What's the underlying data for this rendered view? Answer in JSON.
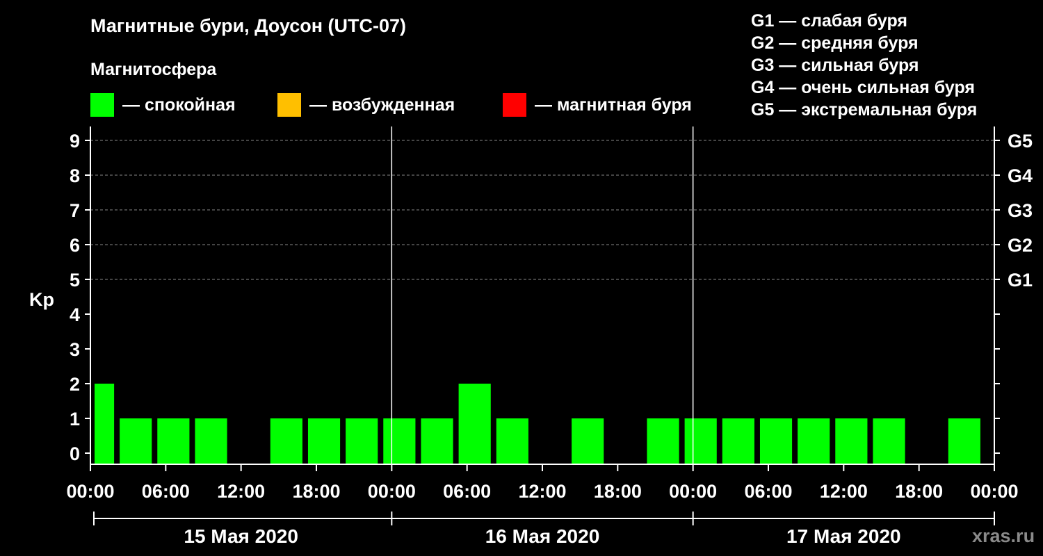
{
  "title": "Магнитные бури, Доусон (UTC-07)",
  "legend": {
    "header": "Магнитосфера",
    "items": [
      {
        "label": "— спокойная",
        "color": "#00ff00"
      },
      {
        "label": "— возбужденная",
        "color": "#ffbf00"
      },
      {
        "label": "— магнитная буря",
        "color": "#ff0000"
      }
    ]
  },
  "g_scale": [
    "G1 — слабая буря",
    "G2 — средняя буря",
    "G3 — сильная буря",
    "G4 — очень сильная буря",
    "G5 — экстремальная буря"
  ],
  "watermark": "xras.ru",
  "chart_data": {
    "type": "bar",
    "ylabel": "Kp",
    "ylim": [
      0,
      9
    ],
    "yticks": [
      "0",
      "1",
      "2",
      "3",
      "4",
      "5",
      "6",
      "7",
      "8",
      "9"
    ],
    "right_ticks": [
      {
        "kp": 5,
        "label": "G1"
      },
      {
        "kp": 6,
        "label": "G2"
      },
      {
        "kp": 7,
        "label": "G3"
      },
      {
        "kp": 8,
        "label": "G4"
      },
      {
        "kp": 9,
        "label": "G5"
      }
    ],
    "xtick_labels": [
      "00:00",
      "06:00",
      "12:00",
      "18:00",
      "00:00",
      "06:00",
      "12:00",
      "18:00",
      "00:00",
      "06:00",
      "12:00",
      "18:00",
      "00:00"
    ],
    "days": [
      "15 Мая 2020",
      "16 Мая 2020",
      "17 Мая 2020"
    ],
    "grid_lines_kp": [
      5,
      6,
      7,
      8,
      9
    ],
    "bar_color": "#00ff00",
    "bars": [
      {
        "start_hour": 0,
        "end_hour": 2,
        "kp": 2
      },
      {
        "start_hour": 2,
        "end_hour": 5,
        "kp": 1
      },
      {
        "start_hour": 5,
        "end_hour": 8,
        "kp": 1
      },
      {
        "start_hour": 8,
        "end_hour": 11,
        "kp": 1
      },
      {
        "start_hour": 14,
        "end_hour": 17,
        "kp": 1
      },
      {
        "start_hour": 17,
        "end_hour": 20,
        "kp": 1
      },
      {
        "start_hour": 20,
        "end_hour": 23,
        "kp": 1
      },
      {
        "start_hour": 23,
        "end_hour": 26,
        "kp": 1
      },
      {
        "start_hour": 26,
        "end_hour": 29,
        "kp": 1
      },
      {
        "start_hour": 29,
        "end_hour": 32,
        "kp": 2
      },
      {
        "start_hour": 32,
        "end_hour": 35,
        "kp": 1
      },
      {
        "start_hour": 38,
        "end_hour": 41,
        "kp": 1
      },
      {
        "start_hour": 44,
        "end_hour": 47,
        "kp": 1
      },
      {
        "start_hour": 47,
        "end_hour": 50,
        "kp": 1
      },
      {
        "start_hour": 50,
        "end_hour": 53,
        "kp": 1
      },
      {
        "start_hour": 53,
        "end_hour": 56,
        "kp": 1
      },
      {
        "start_hour": 56,
        "end_hour": 59,
        "kp": 1
      },
      {
        "start_hour": 59,
        "end_hour": 62,
        "kp": 1
      },
      {
        "start_hour": 62,
        "end_hour": 65,
        "kp": 1
      },
      {
        "start_hour": 68,
        "end_hour": 71,
        "kp": 1
      }
    ]
  }
}
